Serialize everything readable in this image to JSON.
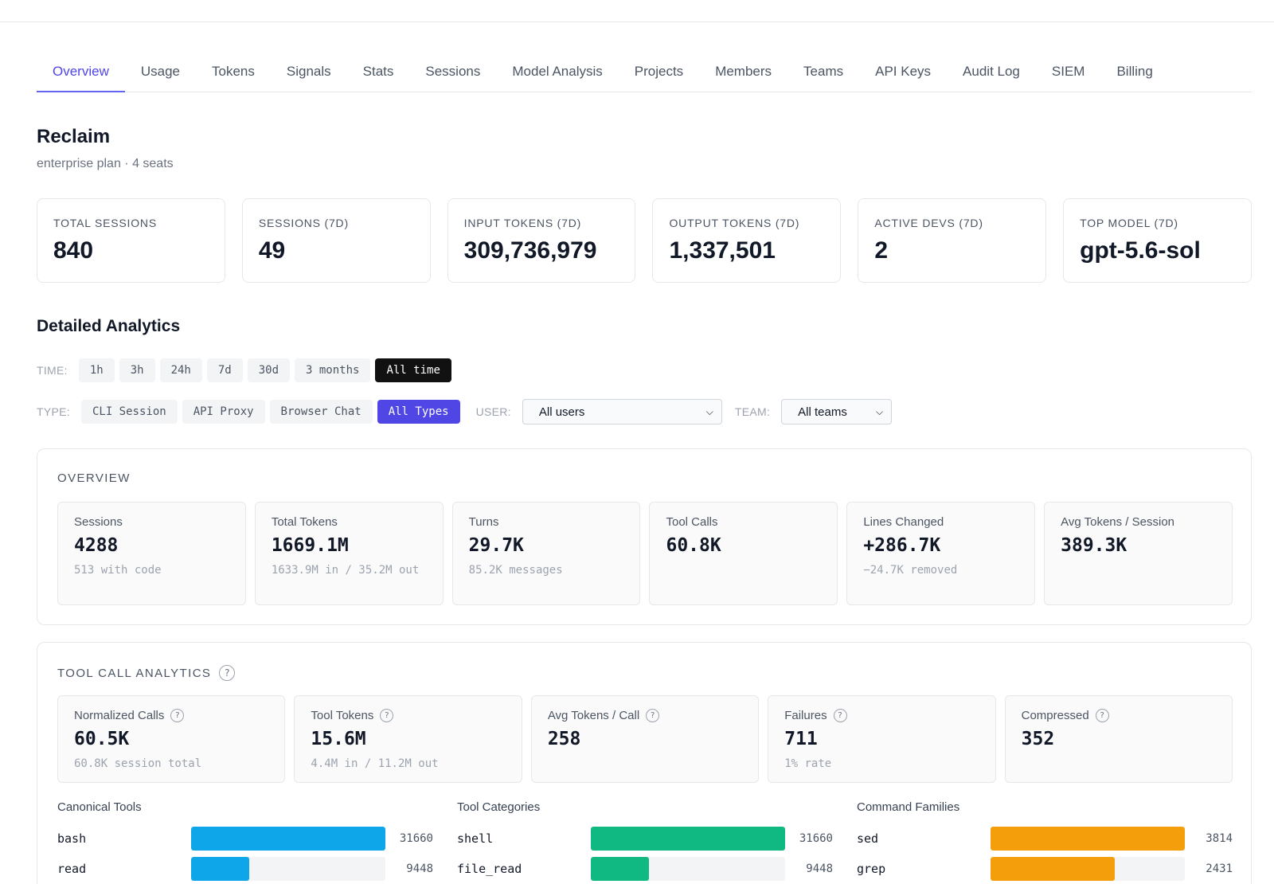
{
  "tabs": [
    {
      "label": "Overview",
      "active": true
    },
    {
      "label": "Usage"
    },
    {
      "label": "Tokens"
    },
    {
      "label": "Signals"
    },
    {
      "label": "Stats"
    },
    {
      "label": "Sessions"
    },
    {
      "label": "Model Analysis"
    },
    {
      "label": "Projects"
    },
    {
      "label": "Members"
    },
    {
      "label": "Teams"
    },
    {
      "label": "API Keys"
    },
    {
      "label": "Audit Log"
    },
    {
      "label": "SIEM"
    },
    {
      "label": "Billing"
    }
  ],
  "org": {
    "name": "Reclaim",
    "subtitle": "enterprise plan · 4 seats"
  },
  "kpis": [
    {
      "label": "Total Sessions",
      "value": "840"
    },
    {
      "label": "Sessions (7d)",
      "value": "49"
    },
    {
      "label": "Input Tokens (7d)",
      "value": "309,736,979"
    },
    {
      "label": "Output Tokens (7d)",
      "value": "1,337,501"
    },
    {
      "label": "Active Devs (7d)",
      "value": "2"
    },
    {
      "label": "Top Model (7d)",
      "value": "gpt-5.6-sol"
    }
  ],
  "detailed": {
    "title": "Detailed Analytics",
    "time_label": "TIME:",
    "time_options": [
      "1h",
      "3h",
      "24h",
      "7d",
      "30d",
      "3 months",
      "All time"
    ],
    "time_selected": "All time",
    "type_label": "TYPE:",
    "type_options": [
      "CLI Session",
      "API Proxy",
      "Browser Chat",
      "All Types"
    ],
    "type_selected": "All Types",
    "user_label": "USER:",
    "user_value": "All users",
    "team_label": "TEAM:",
    "team_value": "All teams"
  },
  "overview": {
    "title": "OVERVIEW",
    "stats": [
      {
        "label": "Sessions",
        "value": "4288",
        "sub": "513 with code"
      },
      {
        "label": "Total Tokens",
        "value": "1669.1M",
        "sub": "1633.9M in / 35.2M out"
      },
      {
        "label": "Turns",
        "value": "29.7K",
        "sub": "85.2K messages"
      },
      {
        "label": "Tool Calls",
        "value": "60.8K",
        "sub": ""
      },
      {
        "label": "Lines Changed",
        "value": "+286.7K",
        "sub": "−24.7K removed"
      },
      {
        "label": "Avg Tokens / Session",
        "value": "389.3K",
        "sub": ""
      }
    ]
  },
  "tool_calls": {
    "title": "TOOL CALL ANALYTICS",
    "help": "?",
    "stats": [
      {
        "label": "Normalized Calls",
        "value": "60.5K",
        "sub": "60.8K session total"
      },
      {
        "label": "Tool Tokens",
        "value": "15.6M",
        "sub": "4.4M in / 11.2M out"
      },
      {
        "label": "Avg Tokens / Call",
        "value": "258",
        "sub": ""
      },
      {
        "label": "Failures",
        "value": "711",
        "sub": "1% rate"
      },
      {
        "label": "Compressed",
        "value": "352",
        "sub": ""
      }
    ],
    "breakdowns": [
      {
        "title": "Canonical Tools",
        "color": "#0ea5e9",
        "max": 31660,
        "rows": [
          {
            "name": "bash",
            "value": 31660
          },
          {
            "name": "read",
            "value": 9448
          }
        ]
      },
      {
        "title": "Tool Categories",
        "color": "#10b981",
        "max": 31660,
        "rows": [
          {
            "name": "shell",
            "value": 31660
          },
          {
            "name": "file_read",
            "value": 9448
          }
        ]
      },
      {
        "title": "Command Families",
        "color": "#f59e0b",
        "max": 3814,
        "rows": [
          {
            "name": "sed",
            "value": 3814
          },
          {
            "name": "grep",
            "value": 2431
          }
        ]
      }
    ]
  }
}
